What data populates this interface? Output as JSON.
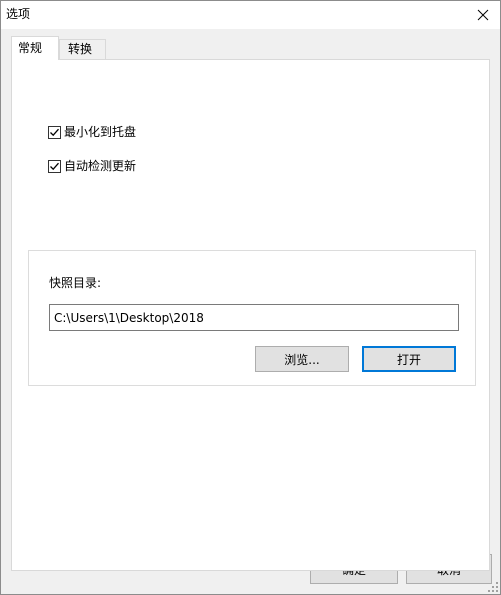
{
  "window": {
    "title": "选项",
    "close_icon": "close-icon"
  },
  "tabs": [
    {
      "label": "常规",
      "active": true
    },
    {
      "label": "转换",
      "active": false
    }
  ],
  "general": {
    "minimize_to_tray": {
      "label": "最小化到托盘",
      "checked": true
    },
    "auto_check_update": {
      "label": "自动检测更新",
      "checked": true
    },
    "snapshot_group": {
      "label": "快照目录:",
      "path_value": "C:\\Users\\1\\Desktop\\2018",
      "browse_label": "浏览...",
      "open_label": "打开"
    }
  },
  "footer": {
    "ok_label": "确定",
    "cancel_label": "取消"
  },
  "colors": {
    "accent": "#0078d7",
    "button_face": "#e1e1e1",
    "window_bg": "#f0f0f0"
  }
}
